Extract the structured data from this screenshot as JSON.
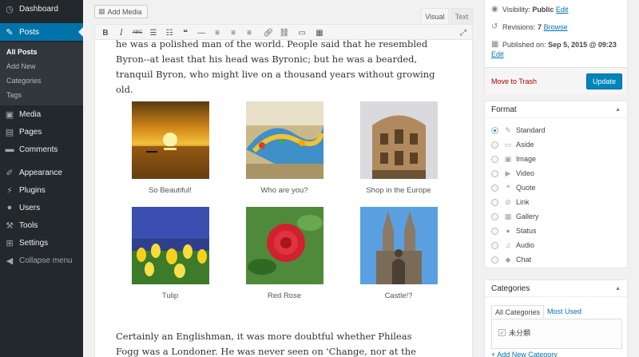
{
  "sidebar": {
    "dashboard": "Dashboard",
    "posts": "Posts",
    "sub": [
      "All Posts",
      "Add New",
      "Categories",
      "Tags"
    ],
    "media": "Media",
    "pages": "Pages",
    "comments": "Comments",
    "appearance": "Appearance",
    "plugins": "Plugins",
    "users": "Users",
    "tools": "Tools",
    "settings": "Settings",
    "collapse": "Collapse menu"
  },
  "editor": {
    "add_media": "Add Media",
    "tab_visual": "Visual",
    "tab_text": "Text",
    "para1": "he was a polished man of the world.  People said that he resembled Byron--at least that his head was Byronic; but he was a bearded, tranquil Byron, who might live on a thousand years without growing old.",
    "para2": "Certainly an Englishman, it was more doubtful whether Phileas Fogg was a Londoner.  He was never seen on 'Change, nor at the Bank, nor in the",
    "gallery": [
      {
        "caption": "So Beautiful!"
      },
      {
        "caption": "Who are you?"
      },
      {
        "caption": "Shop in the Europe"
      },
      {
        "caption": "Tulip"
      },
      {
        "caption": "Red Rose"
      },
      {
        "caption": "Castle!?"
      }
    ]
  },
  "publish": {
    "visibility_label": "Visibility:",
    "visibility_value": "Public",
    "revisions_label": "Revisions:",
    "revisions_value": "7",
    "browse": "Browse",
    "published_label": "Published on:",
    "published_value": "Sep 5, 2015 @ 09:23",
    "edit": "Edit",
    "trash": "Move to Trash",
    "update": "Update"
  },
  "format": {
    "title": "Format",
    "options": [
      "Standard",
      "Aside",
      "Image",
      "Video",
      "Quote",
      "Link",
      "Gallery",
      "Status",
      "Audio",
      "Chat"
    ],
    "selected": "Standard"
  },
  "categories": {
    "title": "Categories",
    "tab_all": "All Categories",
    "tab_used": "Most Used",
    "item": "未分類",
    "add_new": "+ Add New Category"
  }
}
